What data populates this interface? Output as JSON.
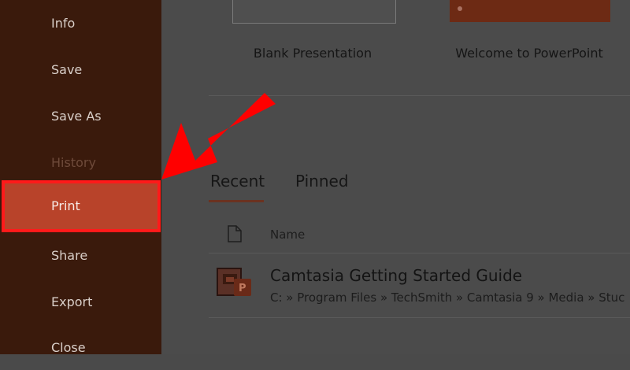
{
  "sidebar": {
    "items": [
      {
        "label": "Info",
        "state": "normal"
      },
      {
        "label": "Save",
        "state": "normal"
      },
      {
        "label": "Save As",
        "state": "normal"
      },
      {
        "label": "History",
        "state": "disabled"
      },
      {
        "label": "Print",
        "state": "active"
      },
      {
        "label": "Share",
        "state": "normal"
      },
      {
        "label": "Export",
        "state": "normal"
      },
      {
        "label": "Close",
        "state": "normal"
      }
    ]
  },
  "templates": {
    "blank_label": "Blank Presentation",
    "welcome_label": "Welcome to PowerPoint"
  },
  "tabs": {
    "recent": "Recent",
    "pinned": "Pinned"
  },
  "file_list": {
    "header_name": "Name",
    "files": [
      {
        "name": "Camtasia Getting Started Guide",
        "path": "C: » Program Files » TechSmith » Camtasia 9 » Media » Stuc"
      }
    ]
  },
  "colors": {
    "sidebar_bg": "#3a1a0c",
    "active_item_bg": "#b8432a",
    "highlight_red": "#ff1a1a"
  },
  "icons": {
    "file_header": "document-icon",
    "file_item": "powerpoint-file-icon",
    "annotation": "red-arrow"
  }
}
